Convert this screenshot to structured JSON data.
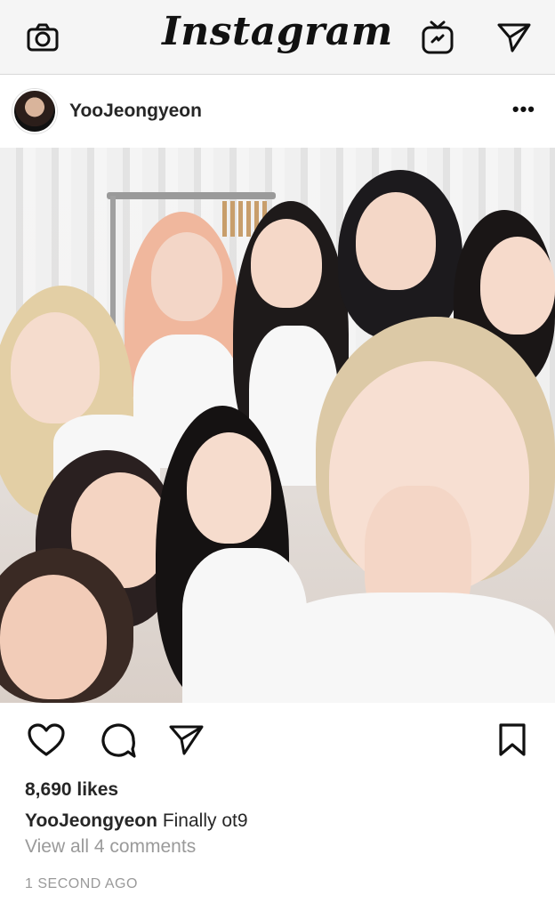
{
  "app": {
    "brand": "Instagram"
  },
  "topbar": {
    "left_icon": "camera-icon",
    "right_icons": [
      "igtv-icon",
      "direct-message-icon"
    ]
  },
  "post": {
    "username": "YooJeongyeon",
    "more_icon": "more-options-icon",
    "actions": {
      "left": [
        "heart-icon",
        "comment-icon",
        "share-icon"
      ],
      "right": "bookmark-icon"
    },
    "likes": "8,690 likes",
    "caption_user": "YooJeongyeon",
    "caption_text": "Finally ot9",
    "view_comments": "View all 4 comments",
    "timestamp": "1 SECOND AGO"
  },
  "colors": {
    "topbar_bg": "#f5f5f5",
    "text_primary": "#262626",
    "text_secondary": "#9a9a9a"
  }
}
